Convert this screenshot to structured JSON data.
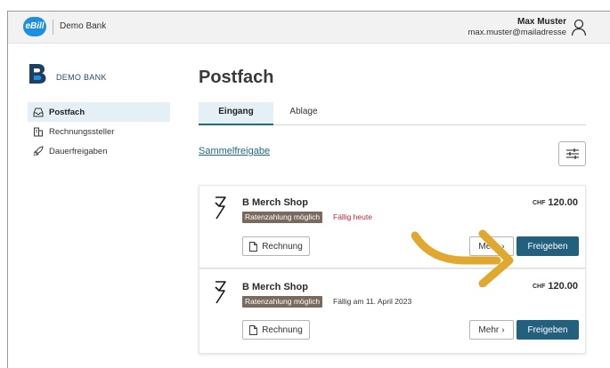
{
  "header": {
    "logo_text": "eBill",
    "bank_name": "Demo Bank",
    "user_name": "Max Muster",
    "user_email": "max.muster@mailadresse"
  },
  "sidebar": {
    "brand_name": "DEMO BANK",
    "items": [
      {
        "label": "Postfach",
        "icon": "inbox-icon",
        "active": true
      },
      {
        "label": "Rechnungssteller",
        "icon": "building-icon",
        "active": false
      },
      {
        "label": "Dauerfreigaben",
        "icon": "rocket-icon",
        "active": false
      }
    ]
  },
  "main": {
    "title": "Postfach",
    "tabs": [
      {
        "label": "Eingang",
        "active": true
      },
      {
        "label": "Ablage",
        "active": false
      }
    ],
    "bulk_link": "Sammelfreigabe",
    "bills": [
      {
        "biller": "B Merch Shop",
        "badge": "Ratenzahlung möglich",
        "due": "Fällig heute",
        "due_status": "today",
        "currency": "CHF",
        "amount": "120.00",
        "invoice_label": "Rechnung",
        "more_label": "Mehr",
        "approve_label": "Freigeben"
      },
      {
        "biller": "B Merch Shop",
        "badge": "Ratenzahlung möglich",
        "due": "Fällig am 11. April 2023",
        "due_status": "future",
        "currency": "CHF",
        "amount": "120.00",
        "invoice_label": "Rechnung",
        "more_label": "Mehr",
        "approve_label": "Freigeben"
      }
    ]
  },
  "colors": {
    "accent": "#23607d",
    "link": "#1d6a8a",
    "due_today": "#c0243a",
    "badge_bg": "#7a6a5e",
    "annotation_arrow": "#e0a82e"
  }
}
